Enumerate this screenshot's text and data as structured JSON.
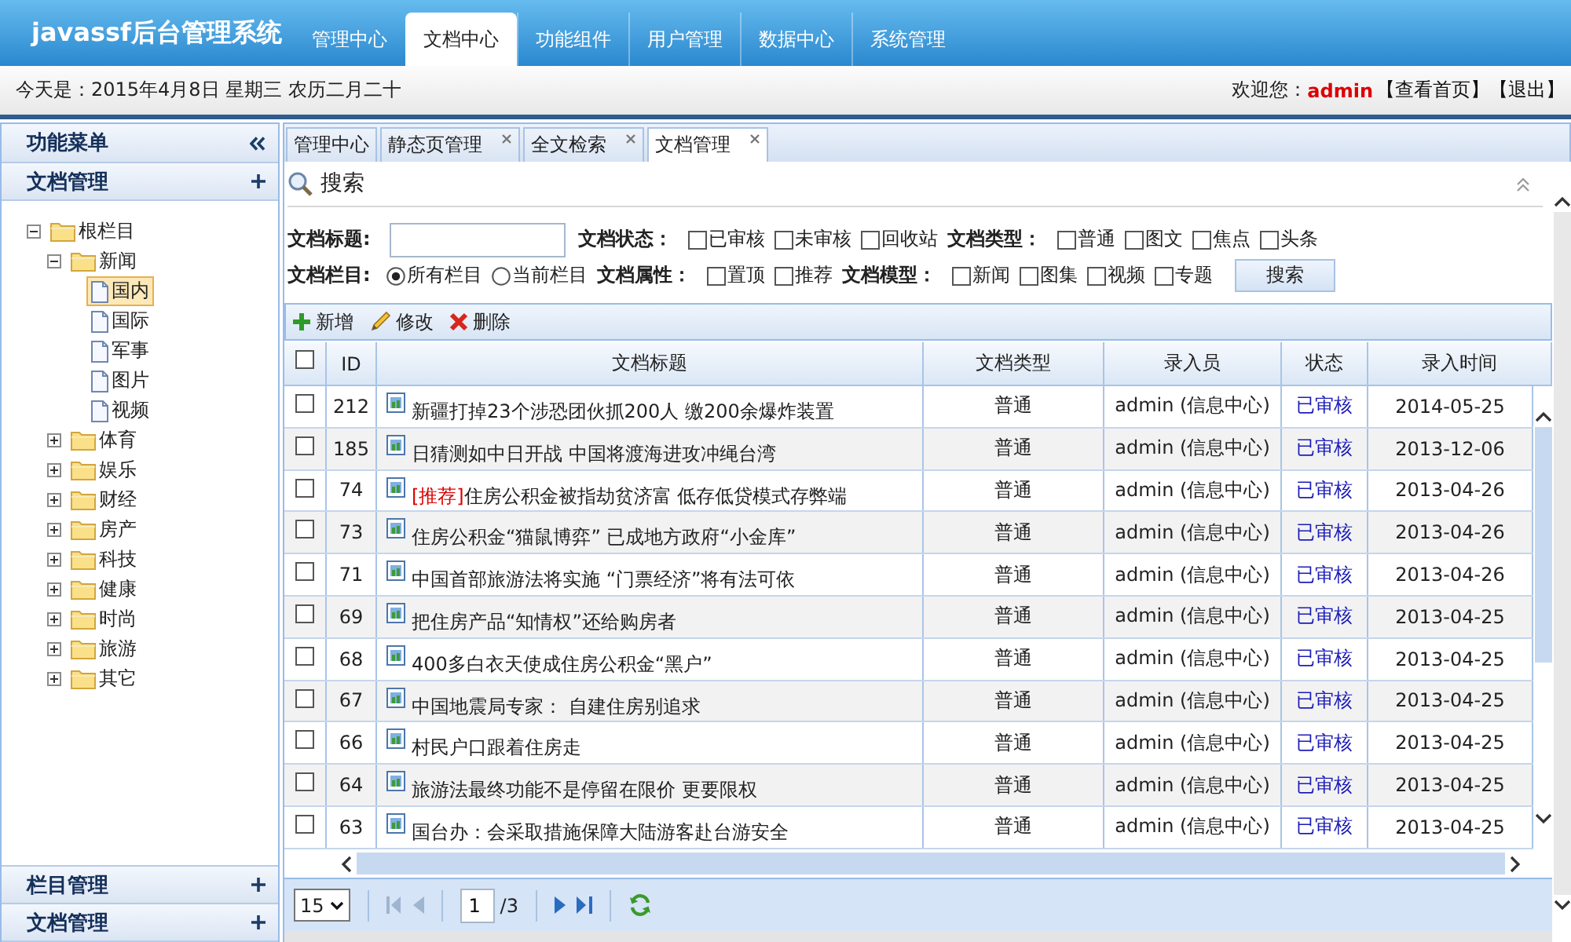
{
  "header": {
    "logo": "javassf后台管理系统",
    "nav": [
      {
        "label": "管理中心",
        "selected": false
      },
      {
        "label": "文档中心",
        "selected": true
      },
      {
        "label": "功能组件",
        "selected": false
      },
      {
        "label": "用户管理",
        "selected": false
      },
      {
        "label": "数据中心",
        "selected": false
      },
      {
        "label": "系统管理",
        "selected": false
      }
    ]
  },
  "info_bar": {
    "date": "今天是：2015年4月8日 星期三 农历二月二十",
    "welcome": "欢迎您：",
    "user": "admin",
    "links": [
      "【查看首页】",
      "【退出】"
    ]
  },
  "sidebar": {
    "title": "功能菜单",
    "panels": [
      {
        "title": "文档管理",
        "tree": [
          {
            "label": "根栏目",
            "kind": "folder",
            "expanded": true,
            "selected": false,
            "children": [
              {
                "label": "新闻",
                "kind": "folder",
                "expanded": true,
                "selected": false,
                "children": [
                  {
                    "label": "国内",
                    "kind": "page",
                    "selected": true
                  },
                  {
                    "label": "国际",
                    "kind": "page",
                    "selected": false
                  },
                  {
                    "label": "军事",
                    "kind": "page",
                    "selected": false
                  },
                  {
                    "label": "图片",
                    "kind": "page",
                    "selected": false
                  },
                  {
                    "label": "视频",
                    "kind": "page",
                    "selected": false
                  }
                ]
              },
              {
                "label": "体育",
                "kind": "folder",
                "expanded": false,
                "selected": false
              },
              {
                "label": "娱乐",
                "kind": "folder",
                "expanded": false,
                "selected": false
              },
              {
                "label": "财经",
                "kind": "folder",
                "expanded": false,
                "selected": false
              },
              {
                "label": "房产",
                "kind": "folder",
                "expanded": false,
                "selected": false
              },
              {
                "label": "科技",
                "kind": "folder",
                "expanded": false,
                "selected": false
              },
              {
                "label": "健康",
                "kind": "folder",
                "expanded": false,
                "selected": false
              },
              {
                "label": "时尚",
                "kind": "folder",
                "expanded": false,
                "selected": false
              },
              {
                "label": "旅游",
                "kind": "folder",
                "expanded": false,
                "selected": false
              },
              {
                "label": "其它",
                "kind": "folder",
                "expanded": false,
                "selected": false
              }
            ]
          }
        ]
      },
      {
        "title": "栏目管理"
      },
      {
        "title": "文档管理"
      }
    ]
  },
  "tabs": [
    {
      "label": "管理中心",
      "closable": false,
      "selected": false
    },
    {
      "label": "静态页管理",
      "closable": true,
      "selected": false
    },
    {
      "label": "全文检索",
      "closable": true,
      "selected": false
    },
    {
      "label": "文档管理",
      "closable": true,
      "selected": true
    }
  ],
  "search": {
    "title": "搜索",
    "rows": [
      [
        {
          "kind": "text",
          "label": "文档标题:"
        },
        {
          "kind": "checks",
          "label": "文档状态：",
          "options": [
            {
              "label": "已审核",
              "checked": false
            },
            {
              "label": "未审核",
              "checked": false
            },
            {
              "label": "回收站",
              "checked": false
            }
          ]
        },
        {
          "kind": "checks",
          "label": "文档类型：",
          "options": [
            {
              "label": "普通",
              "checked": false
            },
            {
              "label": "图文",
              "checked": false
            },
            {
              "label": "焦点",
              "checked": false
            },
            {
              "label": "头条",
              "checked": false
            }
          ]
        }
      ],
      [
        {
          "kind": "radios",
          "label": "文档栏目:",
          "options": [
            {
              "label": "所有栏目",
              "selected": true
            },
            {
              "label": "当前栏目",
              "selected": false
            }
          ]
        },
        {
          "kind": "checks",
          "label": "文档属性：",
          "options": [
            {
              "label": "置顶",
              "checked": false
            },
            {
              "label": "推荐",
              "checked": false
            }
          ]
        },
        {
          "kind": "checks",
          "label": "文档模型：",
          "options": [
            {
              "label": "新闻",
              "checked": false
            },
            {
              "label": "图集",
              "checked": false
            },
            {
              "label": "视频",
              "checked": false
            },
            {
              "label": "专题",
              "checked": false
            }
          ]
        },
        {
          "kind": "button",
          "label": "搜索"
        }
      ]
    ]
  },
  "toolbar": [
    {
      "kind": "add",
      "label": "新增"
    },
    {
      "kind": "edit",
      "label": "修改"
    },
    {
      "kind": "delete",
      "label": "删除"
    }
  ],
  "table": {
    "all_checked": false,
    "columns": [
      "ID",
      "文档标题",
      "文档类型",
      "录入员",
      "状态",
      "录入时间"
    ],
    "rows": [
      {
        "checked": false,
        "id": "212",
        "title": "新疆打掉23个涉恐团伙抓200人 缴200余爆炸装置",
        "type": "普通",
        "author": "admin (信息中心)",
        "status": "已审核",
        "date": "2014-05-25"
      },
      {
        "checked": false,
        "id": "185",
        "title": "日猜测如中日开战 中国将渡海进攻冲绳台湾",
        "type": "普通",
        "author": "admin (信息中心)",
        "status": "已审核",
        "date": "2013-12-06"
      },
      {
        "checked": false,
        "id": "74",
        "tag": "[推荐]",
        "title": "住房公积金被指劫贫济富 低存低贷模式存弊端",
        "type": "普通",
        "author": "admin (信息中心)",
        "status": "已审核",
        "date": "2013-04-26"
      },
      {
        "checked": false,
        "id": "73",
        "title": "住房公积金“猫鼠博弈” 已成地方政府“小金库”",
        "type": "普通",
        "author": "admin (信息中心)",
        "status": "已审核",
        "date": "2013-04-26"
      },
      {
        "checked": false,
        "id": "71",
        "title": "中国首部旅游法将实施 “门票经济”将有法可依",
        "type": "普通",
        "author": "admin (信息中心)",
        "status": "已审核",
        "date": "2013-04-26"
      },
      {
        "checked": false,
        "id": "69",
        "title": "把住房产品“知情权”还给购房者",
        "type": "普通",
        "author": "admin (信息中心)",
        "status": "已审核",
        "date": "2013-04-25"
      },
      {
        "checked": false,
        "id": "68",
        "title": "400多白衣天使成住房公积金“黑户”",
        "type": "普通",
        "author": "admin (信息中心)",
        "status": "已审核",
        "date": "2013-04-25"
      },
      {
        "checked": false,
        "id": "67",
        "title": "中国地震局专家： 自建住房别追求",
        "type": "普通",
        "author": "admin (信息中心)",
        "status": "已审核",
        "date": "2013-04-25"
      },
      {
        "checked": false,
        "id": "66",
        "title": "村民户口跟着住房走",
        "type": "普通",
        "author": "admin (信息中心)",
        "status": "已审核",
        "date": "2013-04-25"
      },
      {
        "checked": false,
        "id": "64",
        "title": "旅游法最终功能不是停留在限价 更要限权",
        "type": "普通",
        "author": "admin (信息中心)",
        "status": "已审核",
        "date": "2013-04-25"
      },
      {
        "checked": false,
        "id": "63",
        "title": "国台办：会采取措施保障大陆游客赴台游安全",
        "type": "普通",
        "author": "admin (信息中心)",
        "status": "已审核",
        "date": "2013-04-25"
      }
    ]
  },
  "pager": {
    "page_size": "15",
    "page": "1",
    "total": "/3"
  }
}
